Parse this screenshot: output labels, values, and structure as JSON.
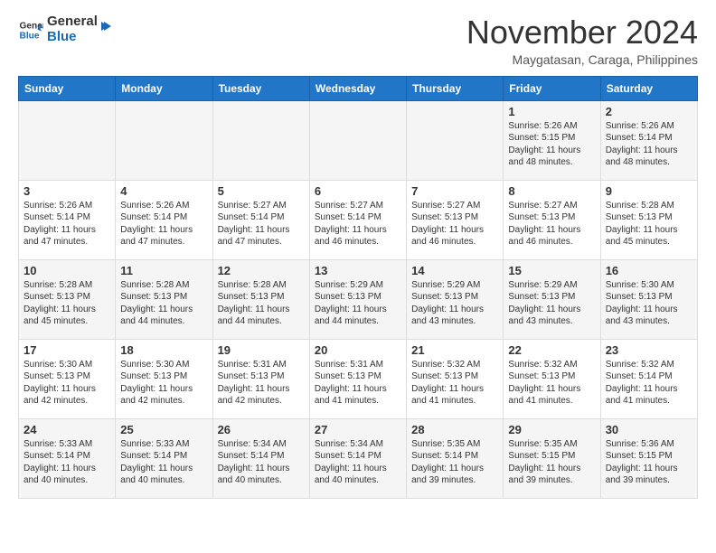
{
  "header": {
    "logo_line1": "General",
    "logo_line2": "Blue",
    "month_title": "November 2024",
    "subtitle": "Maygatasan, Caraga, Philippines"
  },
  "weekdays": [
    "Sunday",
    "Monday",
    "Tuesday",
    "Wednesday",
    "Thursday",
    "Friday",
    "Saturday"
  ],
  "weeks": [
    [
      {
        "day": "",
        "info": ""
      },
      {
        "day": "",
        "info": ""
      },
      {
        "day": "",
        "info": ""
      },
      {
        "day": "",
        "info": ""
      },
      {
        "day": "",
        "info": ""
      },
      {
        "day": "1",
        "info": "Sunrise: 5:26 AM\nSunset: 5:15 PM\nDaylight: 11 hours\nand 48 minutes."
      },
      {
        "day": "2",
        "info": "Sunrise: 5:26 AM\nSunset: 5:14 PM\nDaylight: 11 hours\nand 48 minutes."
      }
    ],
    [
      {
        "day": "3",
        "info": "Sunrise: 5:26 AM\nSunset: 5:14 PM\nDaylight: 11 hours\nand 47 minutes."
      },
      {
        "day": "4",
        "info": "Sunrise: 5:26 AM\nSunset: 5:14 PM\nDaylight: 11 hours\nand 47 minutes."
      },
      {
        "day": "5",
        "info": "Sunrise: 5:27 AM\nSunset: 5:14 PM\nDaylight: 11 hours\nand 47 minutes."
      },
      {
        "day": "6",
        "info": "Sunrise: 5:27 AM\nSunset: 5:14 PM\nDaylight: 11 hours\nand 46 minutes."
      },
      {
        "day": "7",
        "info": "Sunrise: 5:27 AM\nSunset: 5:13 PM\nDaylight: 11 hours\nand 46 minutes."
      },
      {
        "day": "8",
        "info": "Sunrise: 5:27 AM\nSunset: 5:13 PM\nDaylight: 11 hours\nand 46 minutes."
      },
      {
        "day": "9",
        "info": "Sunrise: 5:28 AM\nSunset: 5:13 PM\nDaylight: 11 hours\nand 45 minutes."
      }
    ],
    [
      {
        "day": "10",
        "info": "Sunrise: 5:28 AM\nSunset: 5:13 PM\nDaylight: 11 hours\nand 45 minutes."
      },
      {
        "day": "11",
        "info": "Sunrise: 5:28 AM\nSunset: 5:13 PM\nDaylight: 11 hours\nand 44 minutes."
      },
      {
        "day": "12",
        "info": "Sunrise: 5:28 AM\nSunset: 5:13 PM\nDaylight: 11 hours\nand 44 minutes."
      },
      {
        "day": "13",
        "info": "Sunrise: 5:29 AM\nSunset: 5:13 PM\nDaylight: 11 hours\nand 44 minutes."
      },
      {
        "day": "14",
        "info": "Sunrise: 5:29 AM\nSunset: 5:13 PM\nDaylight: 11 hours\nand 43 minutes."
      },
      {
        "day": "15",
        "info": "Sunrise: 5:29 AM\nSunset: 5:13 PM\nDaylight: 11 hours\nand 43 minutes."
      },
      {
        "day": "16",
        "info": "Sunrise: 5:30 AM\nSunset: 5:13 PM\nDaylight: 11 hours\nand 43 minutes."
      }
    ],
    [
      {
        "day": "17",
        "info": "Sunrise: 5:30 AM\nSunset: 5:13 PM\nDaylight: 11 hours\nand 42 minutes."
      },
      {
        "day": "18",
        "info": "Sunrise: 5:30 AM\nSunset: 5:13 PM\nDaylight: 11 hours\nand 42 minutes."
      },
      {
        "day": "19",
        "info": "Sunrise: 5:31 AM\nSunset: 5:13 PM\nDaylight: 11 hours\nand 42 minutes."
      },
      {
        "day": "20",
        "info": "Sunrise: 5:31 AM\nSunset: 5:13 PM\nDaylight: 11 hours\nand 41 minutes."
      },
      {
        "day": "21",
        "info": "Sunrise: 5:32 AM\nSunset: 5:13 PM\nDaylight: 11 hours\nand 41 minutes."
      },
      {
        "day": "22",
        "info": "Sunrise: 5:32 AM\nSunset: 5:13 PM\nDaylight: 11 hours\nand 41 minutes."
      },
      {
        "day": "23",
        "info": "Sunrise: 5:32 AM\nSunset: 5:14 PM\nDaylight: 11 hours\nand 41 minutes."
      }
    ],
    [
      {
        "day": "24",
        "info": "Sunrise: 5:33 AM\nSunset: 5:14 PM\nDaylight: 11 hours\nand 40 minutes."
      },
      {
        "day": "25",
        "info": "Sunrise: 5:33 AM\nSunset: 5:14 PM\nDaylight: 11 hours\nand 40 minutes."
      },
      {
        "day": "26",
        "info": "Sunrise: 5:34 AM\nSunset: 5:14 PM\nDaylight: 11 hours\nand 40 minutes."
      },
      {
        "day": "27",
        "info": "Sunrise: 5:34 AM\nSunset: 5:14 PM\nDaylight: 11 hours\nand 40 minutes."
      },
      {
        "day": "28",
        "info": "Sunrise: 5:35 AM\nSunset: 5:14 PM\nDaylight: 11 hours\nand 39 minutes."
      },
      {
        "day": "29",
        "info": "Sunrise: 5:35 AM\nSunset: 5:15 PM\nDaylight: 11 hours\nand 39 minutes."
      },
      {
        "day": "30",
        "info": "Sunrise: 5:36 AM\nSunset: 5:15 PM\nDaylight: 11 hours\nand 39 minutes."
      }
    ]
  ]
}
